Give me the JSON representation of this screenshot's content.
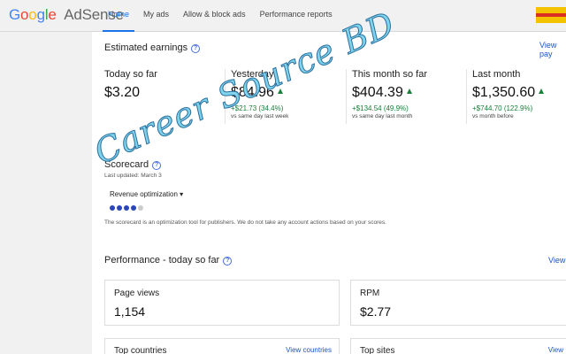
{
  "header": {
    "logo_letters": [
      "G",
      "o",
      "o",
      "g",
      "l",
      "e"
    ],
    "product": "AdSense",
    "nav": [
      "Home",
      "My ads",
      "Allow & block ads",
      "Performance reports"
    ]
  },
  "earnings": {
    "title": "Estimated earnings",
    "view_link": "View pay",
    "stats": [
      {
        "label": "Today so far",
        "value": "$3.20",
        "delta": "",
        "compare": ""
      },
      {
        "label": "Yesterday",
        "value": "$84.96",
        "delta": "+$21.73 (34.4%)",
        "compare": "vs same day last week"
      },
      {
        "label": "This month so far",
        "value": "$404.39",
        "delta": "+$134.54 (49.9%)",
        "compare": "vs same day last month"
      },
      {
        "label": "Last month",
        "value": "$1,350.60",
        "delta": "+$744.70 (122.9%)",
        "compare": "vs month before"
      }
    ]
  },
  "scorecard": {
    "title": "Scorecard",
    "updated": "Last updated: March 3",
    "dropdown": "Revenue optimization",
    "dropdown_arrow": "▾",
    "score": 4,
    "score_max": 5,
    "note": "The scorecard is an optimization tool for publishers. We do not take any account actions based on your scores."
  },
  "performance": {
    "title": "Performance - today so far",
    "view_link": "View",
    "cards": [
      {
        "label": "Page views",
        "value": "1,154"
      },
      {
        "label": "RPM",
        "value": "$2.77"
      }
    ],
    "bottom_cards": [
      {
        "label": "Top countries",
        "link": "View countries"
      },
      {
        "label": "Top sites",
        "link": "View"
      }
    ]
  },
  "watermark": "Career Source BD",
  "colors": {
    "accent": "#1a73e8",
    "positive": "#188038",
    "frame": "#f1f1f1"
  }
}
